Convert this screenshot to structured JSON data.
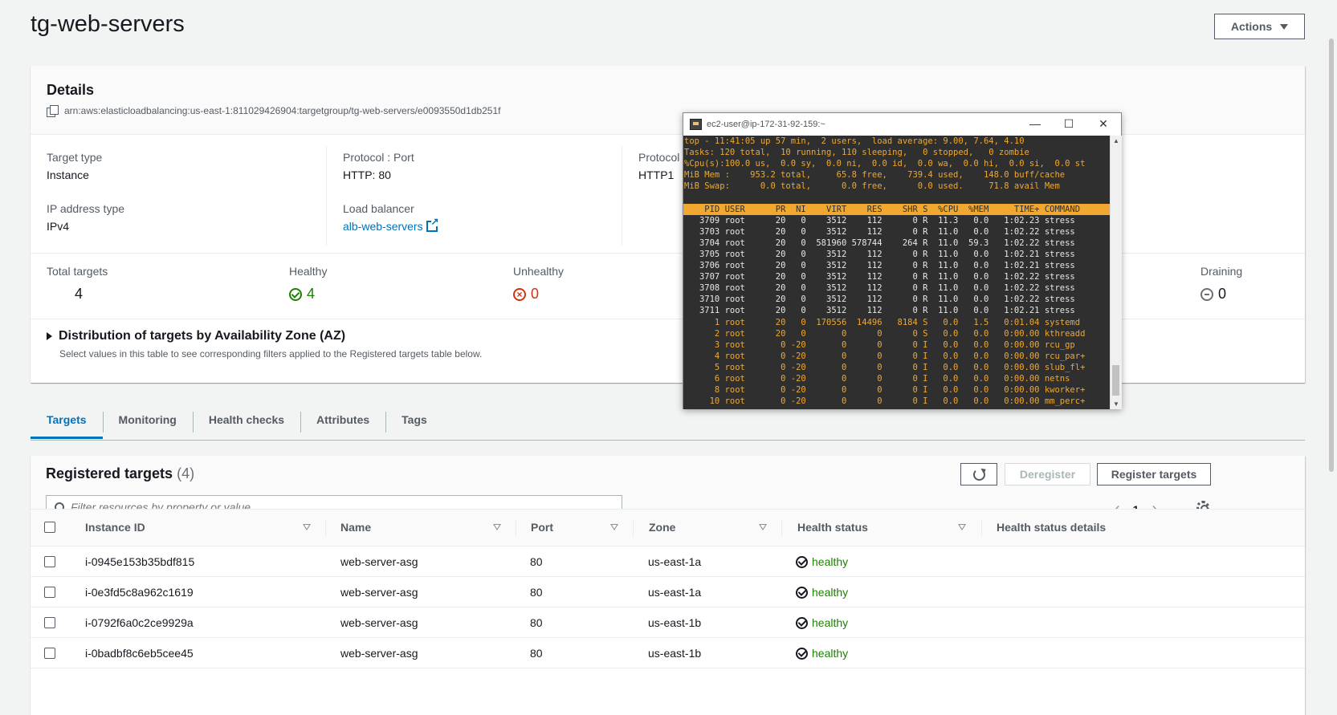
{
  "page": {
    "title": "tg-web-servers",
    "actions_label": "Actions"
  },
  "details": {
    "title": "Details",
    "arn": "arn:aws:elasticloadbalancing:us-east-1:811029426904:targetgroup/tg-web-servers/e0093550d1db251f",
    "target_type_label": "Target type",
    "target_type_value": "Instance",
    "ip_type_label": "IP address type",
    "ip_type_value": "IPv4",
    "protocol_port_label": "Protocol : Port",
    "protocol_port_value": "HTTP: 80",
    "lb_label": "Load balancer",
    "lb_value": "alb-web-servers",
    "protocol_version_label": "Protocol v",
    "protocol_version_value": "HTTP1"
  },
  "counts": {
    "total_label": "Total targets",
    "total_value": "4",
    "healthy_label": "Healthy",
    "healthy_value": "4",
    "unhealthy_label": "Unhealthy",
    "unhealthy_value": "0",
    "draining_label": "Draining",
    "draining_value": "0"
  },
  "az": {
    "title": "Distribution of targets by Availability Zone (AZ)",
    "subtitle": "Select values in this table to see corresponding filters applied to the Registered targets table below."
  },
  "tabs": [
    "Targets",
    "Monitoring",
    "Health checks",
    "Attributes",
    "Tags"
  ],
  "registered": {
    "title": "Registered targets",
    "count": "(4)",
    "deregister_label": "Deregister",
    "register_label": "Register targets",
    "filter_placeholder": "Filter resources by property or value",
    "page": "1",
    "columns": [
      "Instance ID",
      "Name",
      "Port",
      "Zone",
      "Health status",
      "Health status details"
    ],
    "rows": [
      {
        "id": "i-0945e153b35bdf815",
        "name": "web-server-asg",
        "port": "80",
        "zone": "us-east-1a",
        "health": "healthy"
      },
      {
        "id": "i-0e3fd5c8a962c1619",
        "name": "web-server-asg",
        "port": "80",
        "zone": "us-east-1a",
        "health": "healthy"
      },
      {
        "id": "i-0792f6a0c2ce9929a",
        "name": "web-server-asg",
        "port": "80",
        "zone": "us-east-1b",
        "health": "healthy"
      },
      {
        "id": "i-0badbf8c6eb5cee45",
        "name": "web-server-asg",
        "port": "80",
        "zone": "us-east-1b",
        "health": "healthy"
      }
    ]
  },
  "terminal": {
    "title": "ec2-user@ip-172-31-92-159:~",
    "summary": [
      "top - 11:41:05 up 57 min,  2 users,  load average: 9.00, 7.64, 4.10",
      "Tasks: 120 total,  10 running, 110 sleeping,   0 stopped,   0 zombie",
      "%Cpu(s):100.0 us,  0.0 sy,  0.0 ni,  0.0 id,  0.0 wa,  0.0 hi,  0.0 si,  0.0 st",
      "MiB Mem :    953.2 total,     65.8 free,    739.4 used,    148.0 buff/cache",
      "MiB Swap:      0.0 total,      0.0 free,      0.0 used.     71.8 avail Mem",
      ""
    ],
    "header": "    PID USER      PR  NI    VIRT    RES    SHR S  %CPU  %MEM     TIME+ COMMAND",
    "processes_white": [
      "   3709 root      20   0    3512    112      0 R  11.3   0.0   1:02.23 stress",
      "   3703 root      20   0    3512    112      0 R  11.0   0.0   1:02.22 stress",
      "   3704 root      20   0  581960 578744    264 R  11.0  59.3   1:02.22 stress",
      "   3705 root      20   0    3512    112      0 R  11.0   0.0   1:02.21 stress",
      "   3706 root      20   0    3512    112      0 R  11.0   0.0   1:02.21 stress",
      "   3707 root      20   0    3512    112      0 R  11.0   0.0   1:02.22 stress",
      "   3708 root      20   0    3512    112      0 R  11.0   0.0   1:02.22 stress",
      "   3710 root      20   0    3512    112      0 R  11.0   0.0   1:02.22 stress",
      "   3711 root      20   0    3512    112      0 R  11.0   0.0   1:02.21 stress"
    ],
    "processes_orange": [
      "      1 root      20   0  170556  14496   8184 S   0.0   1.5   0:01.04 systemd",
      "      2 root      20   0       0      0      0 S   0.0   0.0   0:00.00 kthreadd",
      "      3 root       0 -20       0      0      0 I   0.0   0.0   0:00.00 rcu_gp",
      "      4 root       0 -20       0      0      0 I   0.0   0.0   0:00.00 rcu_par+",
      "      5 root       0 -20       0      0      0 I   0.0   0.0   0:00.00 slub_fl+",
      "      6 root       0 -20       0      0      0 I   0.0   0.0   0:00.00 netns",
      "      8 root       0 -20       0      0      0 I   0.0   0.0   0:00.00 kworker+",
      "     10 root       0 -20       0      0      0 I   0.0   0.0   0:00.00 mm_perc+"
    ]
  }
}
